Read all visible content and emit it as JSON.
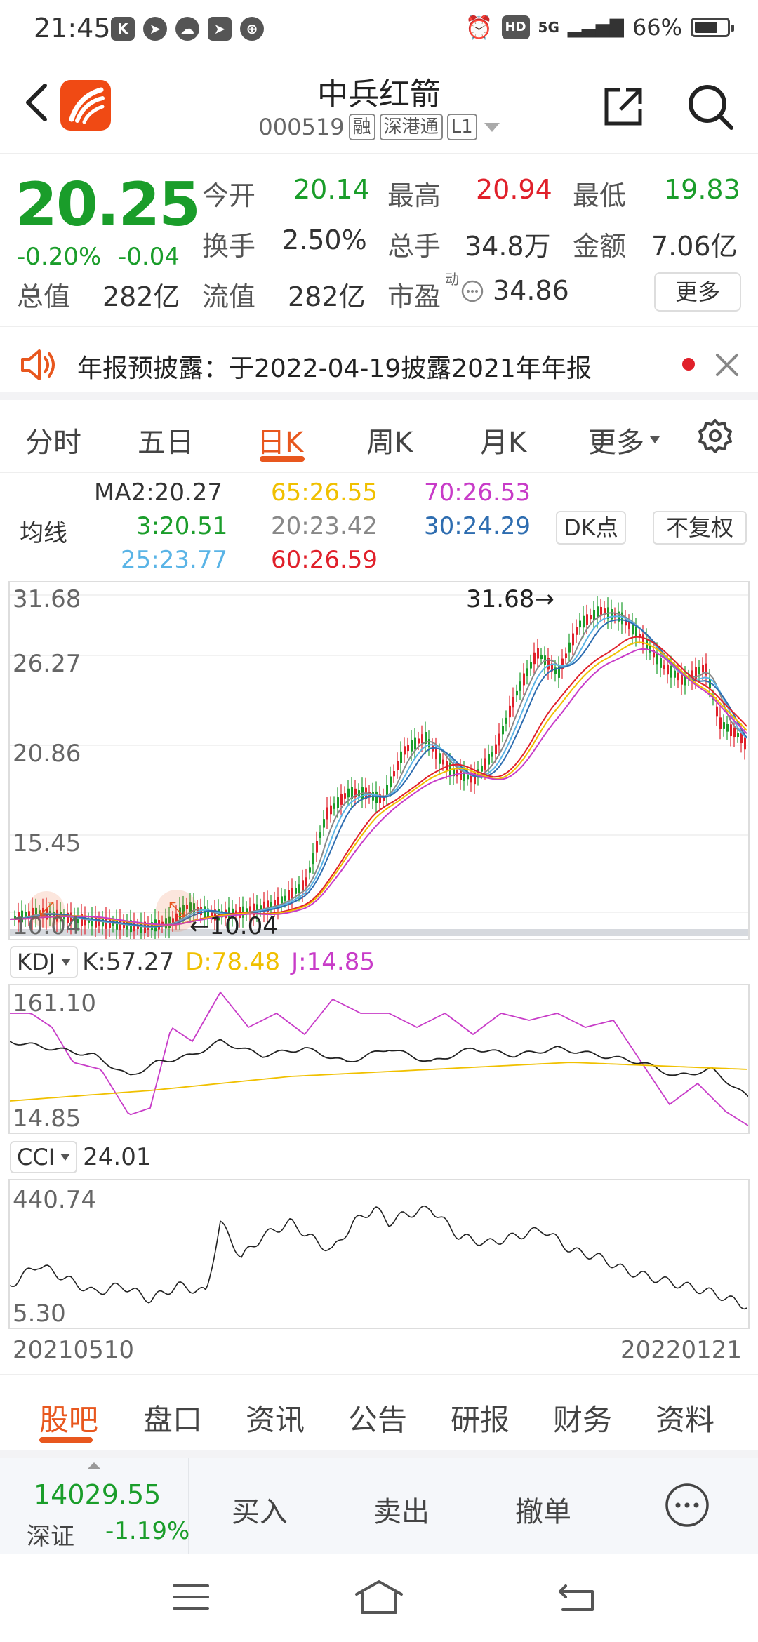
{
  "status": {
    "time": "21:45",
    "battery": "66%",
    "net": "5G"
  },
  "header": {
    "title": "中兵红箭",
    "code": "000519",
    "tag_margin": "融",
    "tag_connect": "深港通",
    "tag_level": "L1"
  },
  "quote": {
    "price": "20.25",
    "change_pct": "-0.20%",
    "change_abs": "-0.04",
    "fields": {
      "open_label": "今开",
      "open": "20.14",
      "high_label": "最高",
      "high": "20.94",
      "low_label": "最低",
      "low": "19.83",
      "turnover_label": "换手",
      "turnover": "2.50%",
      "volume_label": "总手",
      "volume": "34.8万",
      "amount_label": "金额",
      "amount": "7.06亿",
      "mktcap_label": "总值",
      "mktcap": "282亿",
      "float_label": "流值",
      "float": "282亿",
      "pe_label": "市盈",
      "pe_sup": "动",
      "pe": "34.86"
    },
    "more_label": "更多"
  },
  "notice": {
    "text": "年报预披露：于2022-04-19披露2021年年报"
  },
  "period_tabs": [
    "分时",
    "五日",
    "日K",
    "周K",
    "月K",
    "更多"
  ],
  "active_period": "日K",
  "ma": {
    "label": "均线",
    "ma2": "MA2:20.27",
    "ma65": "65:26.55",
    "ma70": "70:26.53",
    "ma3": "3:20.51",
    "ma20": "20:23.42",
    "ma30": "30:24.29",
    "ma25": "25:23.77",
    "ma60": "60:26.59",
    "dk_label": "DK点",
    "adj_label": "不复权"
  },
  "colors": {
    "up": "#e0202a",
    "down": "#1a9d2a",
    "accent": "#e8571e",
    "ma65": "#f0c000",
    "ma70": "#c83cc8",
    "ma3": "#1a9d2a",
    "ma20": "#888888",
    "ma30": "#2e6db0",
    "ma25": "#5ab4e6",
    "ma60": "#e0202a"
  },
  "kline": {
    "ylabels": [
      "31.68",
      "26.27",
      "20.86",
      "15.45",
      "10.04"
    ],
    "max_label": "31.68",
    "min_label": "10.04"
  },
  "kdj": {
    "name": "KDJ",
    "k": "K:57.27",
    "d": "D:78.48",
    "j": "J:14.85",
    "ymax": "161.10",
    "ymin": "14.85"
  },
  "cci": {
    "name": "CCI",
    "value": "24.01",
    "ymax": "440.74",
    "ymin": "5.30"
  },
  "date_start": "20210510",
  "date_end": "20220121",
  "bottom_tabs": [
    "股吧",
    "盘口",
    "资讯",
    "公告",
    "研报",
    "财务",
    "资料"
  ],
  "index": {
    "value": "14029.55",
    "name": "深证",
    "change": "-1.19%"
  },
  "trade": {
    "buy": "买入",
    "sell": "卖出",
    "cancel": "撤单"
  }
}
